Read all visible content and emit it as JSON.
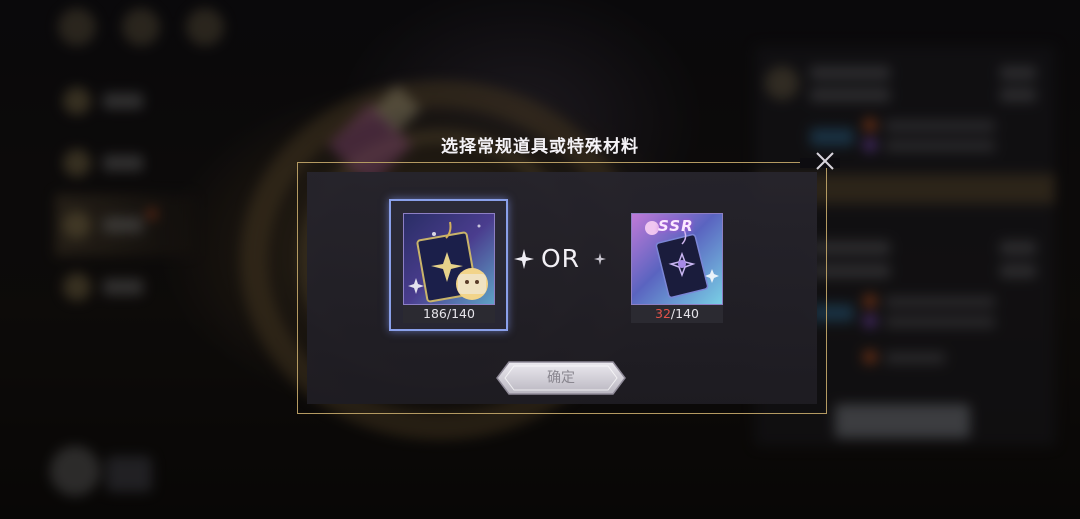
{
  "dialog": {
    "title": "选择常规道具或特殊材料",
    "or_label": "OR",
    "confirm_label": "确定"
  },
  "items": [
    {
      "name": "regular-item",
      "have": "186",
      "need": "/140",
      "selected": true,
      "insufficient": false
    },
    {
      "name": "special-material-ssr",
      "badge": "SSR",
      "have": "32",
      "need": "/140",
      "selected": false,
      "insufficient": true
    }
  ],
  "colors": {
    "frame_gold": "#b49a62",
    "selection_blue": "#8aa0ea",
    "insufficient_red": "#e4534a"
  },
  "icons": [
    "close-icon",
    "sparkle-icon",
    "star-card-icon",
    "ssr-flower-card-icon"
  ]
}
